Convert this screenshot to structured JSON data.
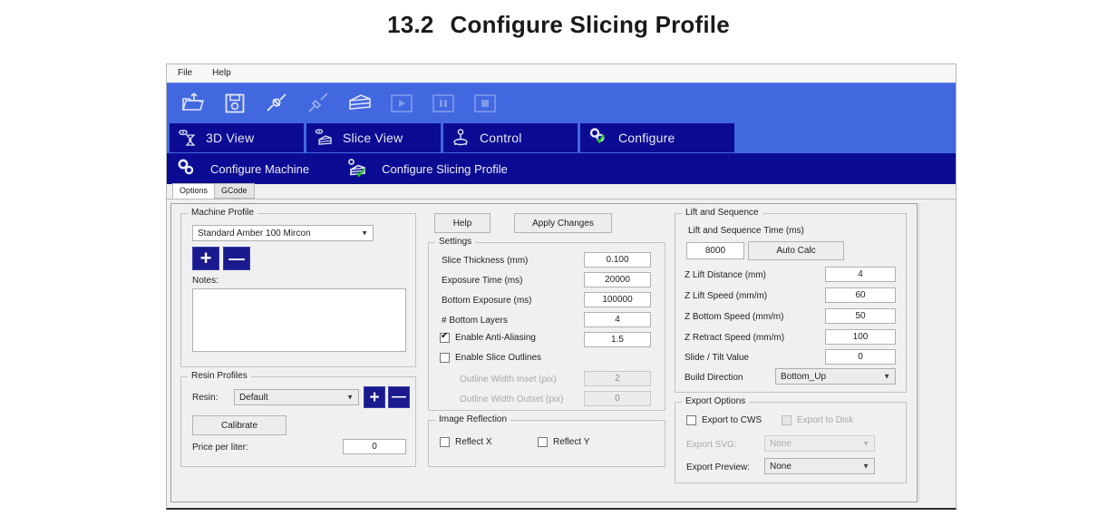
{
  "document": {
    "section_number": "13.2",
    "section_title": "Configure Slicing Profile"
  },
  "menu": {
    "items": [
      {
        "label": "File"
      },
      {
        "label": "Help"
      }
    ]
  },
  "toolbar": {
    "buttons": [
      {
        "name": "open-file",
        "icon": "open-folder-icon"
      },
      {
        "name": "save-file",
        "icon": "floppy-save-icon"
      },
      {
        "name": "connect",
        "icon": "plug-connect-icon"
      },
      {
        "name": "disconnect",
        "icon": "plug-disconnect-icon"
      },
      {
        "name": "slice",
        "icon": "layers-slice-icon"
      },
      {
        "name": "play",
        "icon": "play-icon"
      },
      {
        "name": "pause",
        "icon": "pause-icon"
      },
      {
        "name": "stop",
        "icon": "stop-icon"
      }
    ]
  },
  "nav": {
    "tabs": [
      {
        "label": "3D View",
        "icon": "3d-view-icon"
      },
      {
        "label": "Slice View",
        "icon": "slice-view-icon"
      },
      {
        "label": "Control",
        "icon": "joystick-icon"
      },
      {
        "label": "Configure",
        "icon": "gears-check-icon"
      }
    ]
  },
  "subnav": {
    "items": [
      {
        "label": "Configure Machine",
        "icon": "gears-icon"
      },
      {
        "label": "Configure Slicing Profile",
        "icon": "slice-profile-check-icon"
      }
    ]
  },
  "body_tabs": {
    "tabs": [
      {
        "label": "Options",
        "active": true
      },
      {
        "label": "GCode",
        "active": false
      }
    ]
  },
  "machine_profile": {
    "title": "Machine Profile",
    "profile_value": "Standard Amber 100 Mircon",
    "add_label": "+",
    "remove_label": "—",
    "notes_label": "Notes:",
    "notes_value": ""
  },
  "resin_profiles": {
    "title": "Resin Profiles",
    "resin_label": "Resin:",
    "resin_value": "Default",
    "add_label": "+",
    "remove_label": "—",
    "calibrate_label": "Calibrate",
    "price_label": "Price per liter:",
    "price_value": "0"
  },
  "actions": {
    "help_label": "Help",
    "apply_label": "Apply Changes"
  },
  "settings": {
    "title": "Settings",
    "rows": [
      {
        "label": "Slice Thickness (mm)",
        "value": "0.100",
        "disabled": false
      },
      {
        "label": "Exposure Time (ms)",
        "value": "20000",
        "disabled": false
      },
      {
        "label": "Bottom Exposure (ms)",
        "value": "100000",
        "disabled": false
      },
      {
        "label": "# Bottom Layers",
        "value": "4",
        "disabled": false
      }
    ],
    "anti_aliasing": {
      "label": "Enable Anti-Aliasing",
      "checked": true,
      "value": "1.5"
    },
    "slice_outlines": {
      "label": "Enable Slice Outlines",
      "checked": false
    },
    "outline_rows": [
      {
        "label": "Outline Width Inset (pix)",
        "value": "2",
        "disabled": true
      },
      {
        "label": "Outline Width Outset (pix)",
        "value": "0",
        "disabled": true
      }
    ]
  },
  "image_reflection": {
    "title": "Image Reflection",
    "reflect_x": {
      "label": "Reflect X",
      "checked": false
    },
    "reflect_y": {
      "label": "Reflect Y",
      "checked": false
    }
  },
  "lift_sequence": {
    "title": "Lift and Sequence",
    "time_label": "Lift and Sequence Time (ms)",
    "time_value": "8000",
    "auto_calc_label": "Auto Calc",
    "rows": [
      {
        "label": "Z Lift Distance (mm)",
        "value": "4"
      },
      {
        "label": "Z Lift Speed (mm/m)",
        "value": "60"
      },
      {
        "label": "Z Bottom Speed (mm/m)",
        "value": "50"
      },
      {
        "label": "Z Retract Speed (mm/m)",
        "value": "100"
      },
      {
        "label": "Slide / Tilt Value",
        "value": "0"
      }
    ],
    "build_direction_label": "Build Direction",
    "build_direction_value": "Bottom_Up"
  },
  "export_options": {
    "title": "Export Options",
    "export_cws": {
      "label": "Export to CWS",
      "checked": false,
      "disabled": false
    },
    "export_disk": {
      "label": "Export to Disk",
      "checked": false,
      "disabled": true
    },
    "export_svg": {
      "label": "Export SVG:",
      "value": "None",
      "disabled": true
    },
    "export_preview": {
      "label": "Export Preview:",
      "value": "None",
      "disabled": false
    }
  },
  "colors": {
    "toolbar_blue": "#4268e0",
    "nav_navy": "#0b0b93",
    "button_navy": "#1a1a8e",
    "panel_grey": "#f0f0f0",
    "check_green": "#22c520"
  }
}
